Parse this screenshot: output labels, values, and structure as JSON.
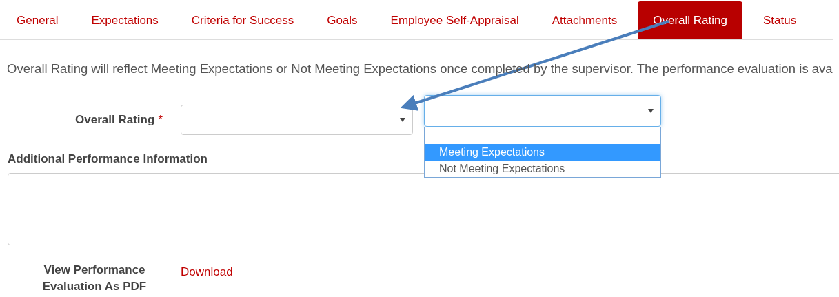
{
  "tabs": [
    {
      "label": "General",
      "selected": false
    },
    {
      "label": "Expectations",
      "selected": false
    },
    {
      "label": "Criteria for Success",
      "selected": false
    },
    {
      "label": "Goals",
      "selected": false
    },
    {
      "label": "Employee Self-Appraisal",
      "selected": false
    },
    {
      "label": "Attachments",
      "selected": false
    },
    {
      "label": "Overall Rating",
      "selected": true
    },
    {
      "label": "Status",
      "selected": false
    }
  ],
  "description": "Overall Rating will reflect Meeting Expectations or Not Meeting Expectations once completed by the supervisor. The performance evaluation is ava",
  "overall_rating": {
    "label": "Overall Rating",
    "required_mark": "*"
  },
  "open_dropdown": {
    "options": [
      {
        "label": "Meeting Expectations",
        "selected": true
      },
      {
        "label": "Not Meeting Expectations",
        "selected": false
      }
    ]
  },
  "additional_info": {
    "label": "Additional Performance Information"
  },
  "pdf": {
    "label": "View Performance Evaluation As PDF",
    "link": "Download"
  }
}
